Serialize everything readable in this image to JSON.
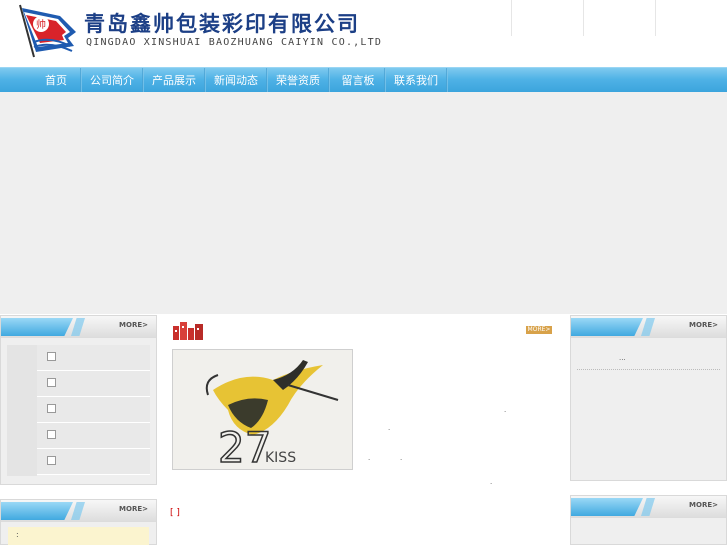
{
  "header": {
    "company_cn": "青岛鑫帅包装彩印有限公司",
    "company_en": "QINGDAO XINSHUAI BAOZHUANG CAIYIN CO.,LTD",
    "logo_char": "帅"
  },
  "nav": {
    "items": [
      "首页",
      "公司简介",
      "产品展示",
      "新闻动态",
      "荣誉资质",
      "留言板",
      "联系我们"
    ]
  },
  "colors": {
    "nav_blue": "#3aa3dc",
    "brand_blue": "#1c3f86",
    "flag_red": "#d8232a",
    "link_red": "#cc0000"
  },
  "left_box": {
    "more_label": "MORE>",
    "items": [
      "",
      "",
      "",
      "",
      ""
    ]
  },
  "left_box2": {
    "more_label": "MORE>",
    "contact_text": ":"
  },
  "center": {
    "more_label": "MORE>",
    "detail_link": "[ ]",
    "dots": [
      ".",
      ".",
      ".",
      ".",
      "."
    ]
  },
  "right_box": {
    "more_label": "MORE>",
    "ellipsis": "..."
  },
  "right_box2": {
    "more_label": "MORE>"
  },
  "photo": {
    "caption_num": "27",
    "caption_word": "KISS"
  }
}
